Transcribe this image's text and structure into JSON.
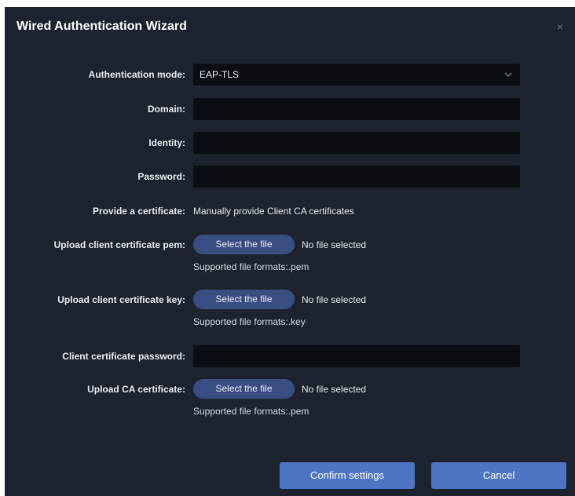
{
  "dialog": {
    "title": "Wired Authentication Wizard",
    "close_glyph": "×"
  },
  "form": {
    "auth_mode": {
      "label": "Authentication mode:",
      "value": "EAP-TLS",
      "icon": "chevron-down-icon"
    },
    "domain": {
      "label": "Domain:",
      "value": ""
    },
    "identity": {
      "label": "Identity:",
      "value": ""
    },
    "password": {
      "label": "Password:",
      "value": ""
    },
    "certificate": {
      "label": "Provide a certificate:",
      "value": "Manually provide Client CA certificates"
    },
    "client_pem": {
      "label": "Upload client certificate pem:",
      "button": "Select the file",
      "status": "No file selected",
      "hint": "Supported file formats:.pem"
    },
    "client_key": {
      "label": "Upload client certificate key:",
      "button": "Select the file",
      "status": "No file selected",
      "hint": "Supported file formats:.key"
    },
    "client_cert_password": {
      "label": "Client certificate password:",
      "value": ""
    },
    "ca_cert": {
      "label": "Upload CA certificate:",
      "button": "Select the file",
      "status": "No file selected",
      "hint": "Supported file formats:.pem"
    }
  },
  "footer": {
    "confirm_label": "Confirm settings",
    "cancel_label": "Cancel"
  },
  "colors": {
    "dialog_bg": "#1d232e",
    "field_bg": "#0a0d12",
    "file_button_bg": "#3a4d83",
    "primary_button_bg": "#4e74c4"
  }
}
